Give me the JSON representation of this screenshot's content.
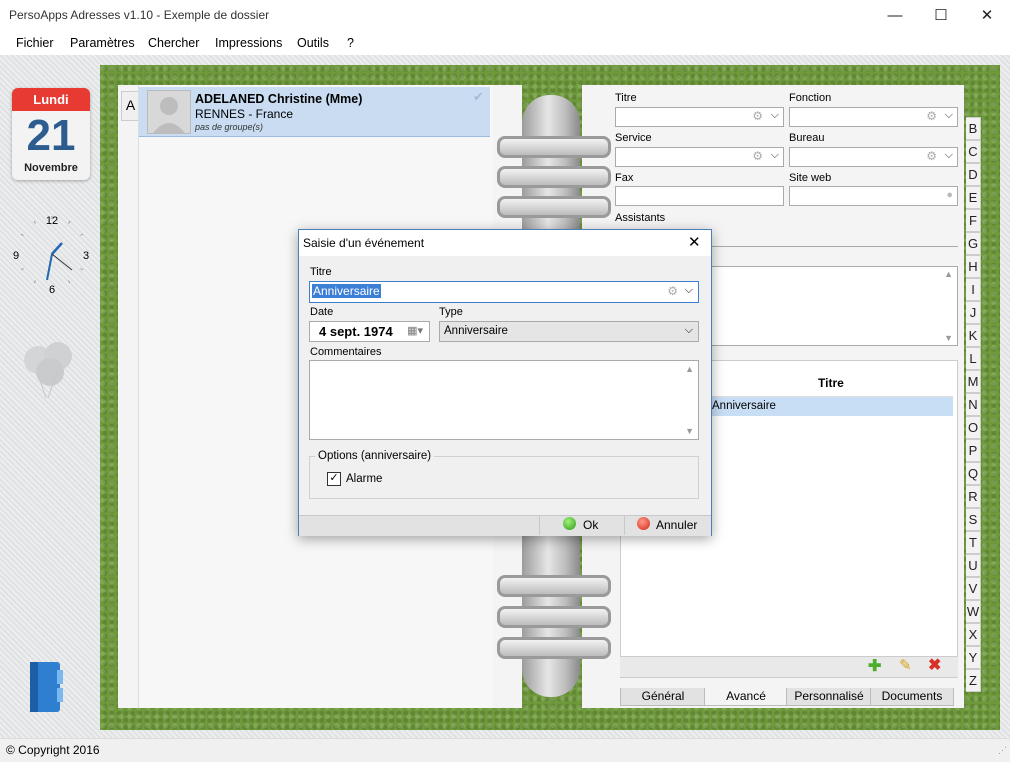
{
  "window": {
    "title": "PersoApps Adresses v1.10 - Exemple de dossier",
    "minimize": "—",
    "maximize": "☐",
    "close": "✕"
  },
  "menu": {
    "items": [
      "Fichier",
      "Paramètres",
      "Chercher",
      "Impressions",
      "Outils",
      "?"
    ]
  },
  "calendar": {
    "weekday": "Lundi",
    "day": "21",
    "month": "Novembre"
  },
  "clock": {
    "labels": [
      "12",
      "3",
      "6",
      "9"
    ]
  },
  "alphabet_tab_active": "A",
  "contact": {
    "name": "ADELANED Christine (Mme)",
    "city": "RENNES - France",
    "group": "pas de groupe(s)",
    "check": "✔"
  },
  "right": {
    "titre_label": "Titre",
    "fonction_label": "Fonction",
    "service_label": "Service",
    "bureau_label": "Bureau",
    "fax_label": "Fax",
    "siteweb_label": "Site web",
    "assistants_label": "Assistants",
    "events_header": "Titre",
    "events_row": "Anniversaire"
  },
  "letters": [
    "B",
    "C",
    "D",
    "E",
    "F",
    "G",
    "H",
    "I",
    "J",
    "K",
    "L",
    "M",
    "N",
    "O",
    "P",
    "Q",
    "R",
    "S",
    "T",
    "U",
    "V",
    "W",
    "X",
    "Y",
    "Z"
  ],
  "bottom_tabs": [
    "Général",
    "Avancé",
    "Personnalisé",
    "Documents"
  ],
  "dialog": {
    "title": "Saisie d'un événement",
    "titre_label": "Titre",
    "titre_value": "Anniversaire",
    "date_label": "Date",
    "date_value": "4 sept. 1974",
    "type_label": "Type",
    "type_value": "Anniversaire",
    "commentaires_label": "Commentaires",
    "options_label": "Options (anniversaire)",
    "alarme_label": "Alarme",
    "alarme_checked": true,
    "ok_label": "Ok",
    "cancel_label": "Annuler"
  },
  "status": {
    "copyright": "© Copyright 2016"
  }
}
